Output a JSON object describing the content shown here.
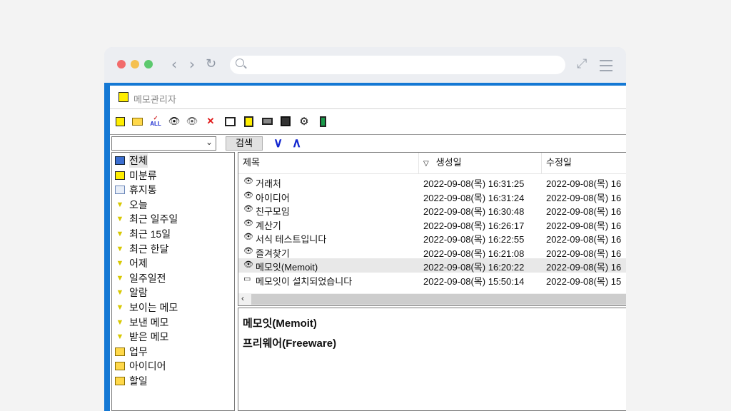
{
  "app": {
    "title": "메모관리자",
    "search_button": "검색",
    "search_value": "",
    "down_arrow": "∨",
    "up_arrow": "∧"
  },
  "toolbar": {
    "icons": [
      "new-memo-icon",
      "open-folder-icon",
      "check-all-icon",
      "show-memo-icon",
      "hide-memo-icon",
      "delete-icon",
      "monitor-icon",
      "export-icon",
      "print-icon",
      "save-icon",
      "settings-icon",
      "exit-icon"
    ]
  },
  "tree": {
    "items": [
      {
        "label": "전체",
        "icon": "all-folder-icon"
      },
      {
        "label": "미분류",
        "icon": "arrow-right-icon"
      },
      {
        "label": "휴지통",
        "icon": "recycle-bin-icon"
      },
      {
        "label": "오늘",
        "icon": "filter-icon"
      },
      {
        "label": "최근 일주일",
        "icon": "filter-icon"
      },
      {
        "label": "최근 15일",
        "icon": "filter-icon"
      },
      {
        "label": "최근 한달",
        "icon": "filter-icon"
      },
      {
        "label": "어제",
        "icon": "filter-icon"
      },
      {
        "label": "일주일전",
        "icon": "filter-icon"
      },
      {
        "label": "알람",
        "icon": "filter-icon"
      },
      {
        "label": "보이는 메모",
        "icon": "filter-icon"
      },
      {
        "label": "보낸 메모",
        "icon": "filter-icon"
      },
      {
        "label": "받은 메모",
        "icon": "filter-icon"
      },
      {
        "label": "업무",
        "icon": "folder-icon"
      },
      {
        "label": "아이디어",
        "icon": "folder-icon"
      },
      {
        "label": "할일",
        "icon": "folder-icon"
      }
    ]
  },
  "list": {
    "columns": [
      "제목",
      "생성일",
      "수정일"
    ],
    "sort_indicator": "▽",
    "rows": [
      {
        "title": "거래처",
        "created": "2022-09-08(목) 16:31:25",
        "modified": "2022-09-08(목) 16",
        "icon": "eye-icon"
      },
      {
        "title": "아이디어",
        "created": "2022-09-08(목) 16:31:24",
        "modified": "2022-09-08(목) 16",
        "icon": "eye-icon"
      },
      {
        "title": "친구모임",
        "created": "2022-09-08(목) 16:30:48",
        "modified": "2022-09-08(목) 16",
        "icon": "eye-icon"
      },
      {
        "title": "계산기",
        "created": "2022-09-08(목) 16:26:17",
        "modified": "2022-09-08(목) 16",
        "icon": "eye-icon"
      },
      {
        "title": "서식 테스트입니다",
        "created": "2022-09-08(목) 16:22:55",
        "modified": "2022-09-08(목) 16",
        "icon": "eye-icon"
      },
      {
        "title": "즐겨찾기",
        "created": "2022-09-08(목) 16:21:08",
        "modified": "2022-09-08(목) 16",
        "icon": "eye-icon"
      },
      {
        "title": "메모잇(Memoit)",
        "created": "2022-09-08(목) 16:20:22",
        "modified": "2022-09-08(목) 16",
        "icon": "eye-icon"
      },
      {
        "title": "메모잇이 설치되었습니다",
        "created": "2022-09-08(목) 15:50:14",
        "modified": "2022-09-08(목) 15",
        "icon": "window-icon"
      }
    ]
  },
  "preview": {
    "lines": [
      "메모잇(Memoit)",
      "프리웨어(Freeware)"
    ]
  }
}
